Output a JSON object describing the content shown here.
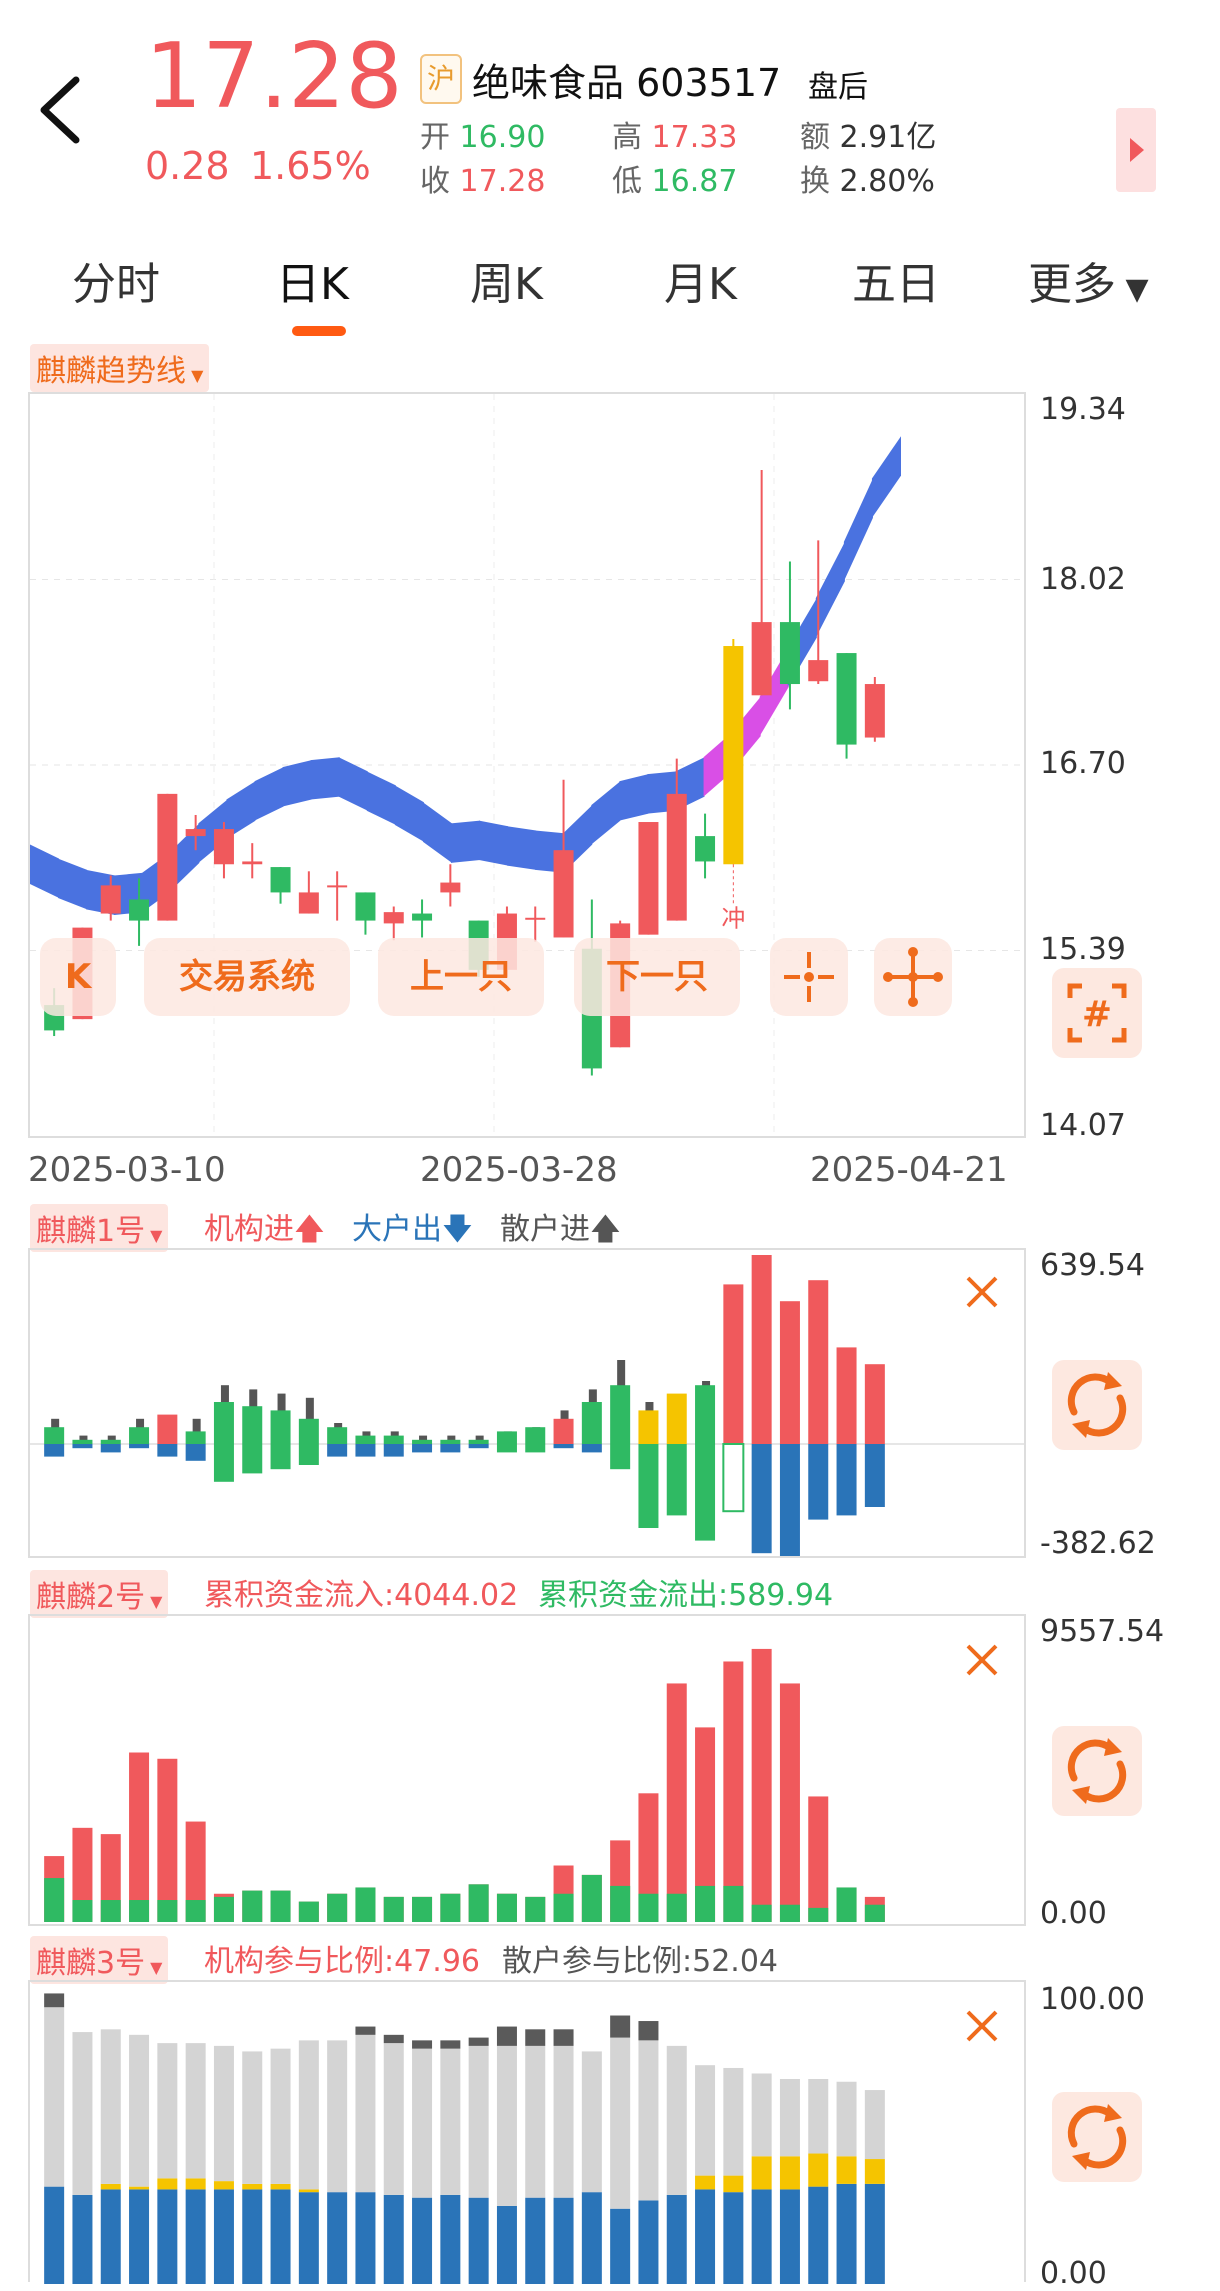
{
  "header": {
    "price": "17.28",
    "change": "0.28",
    "change_pct": "1.65%",
    "exchange_badge": "沪",
    "stock_name": "绝味食品",
    "stock_code": "603517",
    "state": "盘后",
    "quote": [
      {
        "label": "开",
        "value": "16.90"
      },
      {
        "label": "高",
        "value": "17.33"
      },
      {
        "label": "额",
        "value": "2.91亿"
      },
      {
        "label": "收",
        "value": "17.28"
      },
      {
        "label": "低",
        "value": "16.87"
      },
      {
        "label": "换",
        "value": "2.80%"
      }
    ]
  },
  "tabs": [
    "分时",
    "日K",
    "周K",
    "月K",
    "五日",
    "更多"
  ],
  "active_tab": "日K",
  "main_chart": {
    "indicator": "麒麟趋势线",
    "y_labels": [
      "19.34",
      "18.02",
      "16.70",
      "15.39",
      "14.07"
    ],
    "x_labels": [
      "2025-03-10",
      "2025-03-28",
      "2025-04-21"
    ],
    "annotation": "冲",
    "controls": [
      "K",
      "交易系统",
      "上一只",
      "下一只"
    ]
  },
  "ind1": {
    "name": "麒麟1号",
    "legend": [
      {
        "text": "机构进",
        "arrow": "up",
        "color": "#f0595c"
      },
      {
        "text": "大户出",
        "arrow": "down",
        "color": "#2a74b8"
      },
      {
        "text": "散户进",
        "arrow": "up",
        "color": "#555555"
      }
    ],
    "y_top": "639.54",
    "y_bottom": "-382.62"
  },
  "ind2": {
    "name": "麒麟2号",
    "inflow": "累积资金流入:4044.02",
    "outflow": "累积资金流出:589.94",
    "y_top": "9557.54",
    "y_bottom": "0.00"
  },
  "ind3": {
    "name": "麒麟3号",
    "inst_ratio": "机构参与比例:47.96",
    "retail_ratio": "散户参与比例:52.04",
    "y_top": "100.00",
    "y_bottom": "0.00"
  },
  "colors": {
    "up": "#f0595c",
    "down": "#2fba63",
    "accent": "#ef6b1c",
    "blue": "#2a74b8",
    "band": "#4a72e0",
    "band_hot": "#d94fe6",
    "yellow": "#f5c400"
  },
  "chart_data": {
    "type": "candlestick",
    "ylim": [
      14.07,
      19.34
    ],
    "candles": [
      {
        "o": 15.0,
        "h": 15.12,
        "l": 14.78,
        "c": 14.82
      },
      {
        "o": 14.9,
        "h": 15.55,
        "l": 14.9,
        "c": 15.55
      },
      {
        "o": 15.65,
        "h": 15.92,
        "l": 15.6,
        "c": 15.85
      },
      {
        "o": 15.75,
        "h": 15.9,
        "l": 15.42,
        "c": 15.6
      },
      {
        "o": 15.6,
        "h": 16.5,
        "l": 15.6,
        "c": 16.5
      },
      {
        "o": 16.2,
        "h": 16.35,
        "l": 16.1,
        "c": 16.25
      },
      {
        "o": 16.0,
        "h": 16.3,
        "l": 15.9,
        "c": 16.25
      },
      {
        "o": 16.0,
        "h": 16.15,
        "l": 15.9,
        "c": 16.02
      },
      {
        "o": 15.98,
        "h": 15.98,
        "l": 15.72,
        "c": 15.8
      },
      {
        "o": 15.65,
        "h": 15.95,
        "l": 15.65,
        "c": 15.8
      },
      {
        "o": 15.85,
        "h": 15.95,
        "l": 15.6,
        "c": 15.85
      },
      {
        "o": 15.8,
        "h": 15.8,
        "l": 15.5,
        "c": 15.6
      },
      {
        "o": 15.58,
        "h": 15.7,
        "l": 15.46,
        "c": 15.66
      },
      {
        "o": 15.65,
        "h": 15.75,
        "l": 15.48,
        "c": 15.6
      },
      {
        "o": 15.8,
        "h": 16.0,
        "l": 15.7,
        "c": 15.87
      },
      {
        "o": 15.6,
        "h": 15.6,
        "l": 15.2,
        "c": 15.25
      },
      {
        "o": 15.25,
        "h": 15.7,
        "l": 15.2,
        "c": 15.65
      },
      {
        "o": 15.62,
        "h": 15.7,
        "l": 15.45,
        "c": 15.62
      },
      {
        "o": 15.48,
        "h": 16.6,
        "l": 15.48,
        "c": 16.1
      },
      {
        "o": 15.4,
        "h": 15.75,
        "l": 14.5,
        "c": 14.55
      },
      {
        "o": 14.7,
        "h": 15.6,
        "l": 14.7,
        "c": 15.58
      },
      {
        "o": 15.5,
        "h": 16.2,
        "l": 15.5,
        "c": 16.3
      },
      {
        "o": 15.6,
        "h": 16.75,
        "l": 15.6,
        "c": 16.5
      },
      {
        "o": 16.2,
        "h": 16.36,
        "l": 15.9,
        "c": 16.02
      },
      {
        "o": 16.0,
        "h": 17.6,
        "l": 16.0,
        "c": 17.55
      },
      {
        "o": 17.2,
        "h": 18.8,
        "l": 17.2,
        "c": 17.72
      },
      {
        "o": 17.72,
        "h": 18.15,
        "l": 17.1,
        "c": 17.28
      },
      {
        "o": 17.3,
        "h": 18.3,
        "l": 17.28,
        "c": 17.45
      },
      {
        "o": 17.5,
        "h": 17.5,
        "l": 16.75,
        "c": 16.85
      },
      {
        "o": 16.9,
        "h": 17.33,
        "l": 16.87,
        "c": 17.28
      }
    ],
    "highlight_index": 24,
    "trend_band": [
      16.0,
      15.9,
      15.82,
      15.78,
      15.8,
      15.95,
      16.15,
      16.32,
      16.45,
      16.55,
      16.6,
      16.62,
      16.52,
      16.42,
      16.3,
      16.15,
      16.17,
      16.13,
      16.1,
      16.08,
      16.28,
      16.45,
      16.5,
      16.52,
      16.62,
      16.8,
      17.05,
      17.4,
      17.75,
      18.15,
      18.6,
      18.9
    ],
    "ind1_pos": [
      {
        "v": 40,
        "c": "g"
      },
      {
        "v": 10,
        "c": "g"
      },
      {
        "v": 10,
        "c": "g"
      },
      {
        "v": 40,
        "c": "g"
      },
      {
        "v": 70,
        "c": "r"
      },
      {
        "v": 30,
        "c": "g"
      },
      {
        "v": 100,
        "c": "g"
      },
      {
        "v": 90,
        "c": "g"
      },
      {
        "v": 80,
        "c": "g"
      },
      {
        "v": 60,
        "c": "g"
      },
      {
        "v": 40,
        "c": "g"
      },
      {
        "v": 20,
        "c": "g"
      },
      {
        "v": 20,
        "c": "g"
      },
      {
        "v": 10,
        "c": "g"
      },
      {
        "v": 10,
        "c": "g"
      },
      {
        "v": 10,
        "c": "g"
      },
      {
        "v": 30,
        "c": "g"
      },
      {
        "v": 40,
        "c": "g"
      },
      {
        "v": 60,
        "c": "r"
      },
      {
        "v": 100,
        "c": "g"
      },
      {
        "v": 140,
        "c": "g"
      },
      {
        "v": 80,
        "c": "y"
      },
      {
        "v": 120,
        "c": "y"
      },
      {
        "v": 140,
        "c": "g"
      },
      {
        "v": 380,
        "c": "r"
      },
      {
        "v": 450,
        "c": "r"
      },
      {
        "v": 340,
        "c": "r"
      },
      {
        "v": 390,
        "c": "r"
      },
      {
        "v": 230,
        "c": "r"
      },
      {
        "v": 190,
        "c": "r"
      }
    ],
    "ind1_neg": [
      {
        "v": 30,
        "c": "b"
      },
      {
        "v": 10,
        "c": "b"
      },
      {
        "v": 20,
        "c": "b"
      },
      {
        "v": 10,
        "c": "b"
      },
      {
        "v": 30,
        "c": "b"
      },
      {
        "v": 40,
        "c": "b"
      },
      {
        "v": 90,
        "c": "g"
      },
      {
        "v": 70,
        "c": "g"
      },
      {
        "v": 60,
        "c": "g"
      },
      {
        "v": 50,
        "c": "g"
      },
      {
        "v": 30,
        "c": "b"
      },
      {
        "v": 30,
        "c": "b"
      },
      {
        "v": 30,
        "c": "b"
      },
      {
        "v": 20,
        "c": "b"
      },
      {
        "v": 20,
        "c": "b"
      },
      {
        "v": 10,
        "c": "b"
      },
      {
        "v": 20,
        "c": "g"
      },
      {
        "v": 20,
        "c": "g"
      },
      {
        "v": 10,
        "c": "b"
      },
      {
        "v": 20,
        "c": "b"
      },
      {
        "v": 60,
        "c": "g"
      },
      {
        "v": 200,
        "c": "g"
      },
      {
        "v": 170,
        "c": "g"
      },
      {
        "v": 230,
        "c": "g"
      },
      {
        "v": 160,
        "c": "o"
      },
      {
        "v": 260,
        "c": "b"
      },
      {
        "v": 330,
        "c": "b"
      },
      {
        "v": 180,
        "c": "b"
      },
      {
        "v": 170,
        "c": "b"
      },
      {
        "v": 150,
        "c": "b"
      }
    ],
    "ind1_dark": [
      60,
      20,
      20,
      60,
      60,
      60,
      140,
      130,
      120,
      110,
      50,
      30,
      30,
      20,
      20,
      20,
      30,
      40,
      80,
      130,
      200,
      100,
      110,
      150,
      100,
      100,
      200,
      100,
      130,
      170
    ],
    "ind2_green": [
      1400,
      700,
      700,
      700,
      700,
      700,
      800,
      1000,
      1000,
      650,
      900,
      1100,
      800,
      800,
      900,
      1200,
      900,
      800,
      900,
      1500,
      1150,
      900,
      900,
      1150,
      1150,
      550,
      550,
      450,
      1100,
      550
    ],
    "ind2_red": [
      2100,
      3000,
      2800,
      5400,
      5200,
      3200,
      900,
      1000,
      1000,
      650,
      900,
      1100,
      800,
      800,
      900,
      1200,
      900,
      800,
      1800,
      1500,
      2600,
      4100,
      7600,
      6200,
      8300,
      8700,
      7600,
      4000,
      1100,
      800
    ],
    "ind3_blue": [
      36,
      33,
      35,
      35,
      35,
      35,
      35,
      35,
      35,
      34,
      34,
      34,
      33,
      32,
      33,
      32,
      29,
      32,
      32,
      34,
      28,
      31,
      33,
      35,
      34,
      35,
      35,
      36,
      37,
      37
    ],
    "ind3_yellow": [
      0,
      0,
      2,
      1,
      4,
      4,
      3,
      2,
      2,
      1,
      0,
      0,
      0,
      0,
      0,
      0,
      0,
      0,
      0,
      0,
      0,
      0,
      0,
      5,
      6,
      12,
      12,
      12,
      10,
      9
    ],
    "ind3_grey": [
      65,
      59,
      56,
      55,
      49,
      49,
      49,
      48,
      49,
      54,
      55,
      57,
      55,
      54,
      53,
      55,
      58,
      55,
      55,
      51,
      62,
      58,
      54,
      40,
      39,
      30,
      28,
      27,
      27,
      25
    ],
    "ind3_dark": [
      5,
      0,
      0,
      0,
      0,
      0,
      0,
      0,
      0,
      0,
      0,
      3,
      3,
      3,
      3,
      3,
      7,
      6,
      6,
      0,
      8,
      7,
      0,
      0,
      0,
      0,
      0,
      0,
      0,
      0
    ]
  }
}
